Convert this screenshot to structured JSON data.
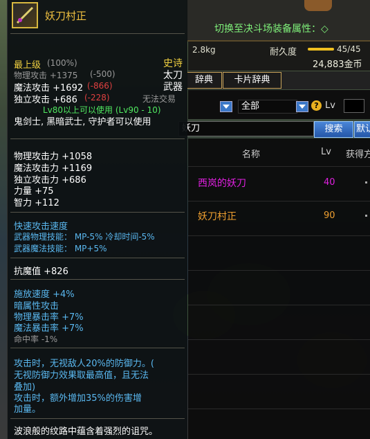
{
  "colors": {
    "accent_gold": "#f0c040",
    "red_penalty": "#e04040",
    "blue_text": "#5ab8f0",
    "green_text": "#50e860",
    "purple_item": "#e020e0",
    "orange_item": "#f0a030",
    "button_blue": "#3c78c8"
  },
  "tooltip": {
    "item_name": "妖刀村正",
    "icon": "katana-icon",
    "grade": "最上级",
    "grade_pct": "(100%)",
    "rarity": "史诗",
    "weapon_type": "太刀",
    "slot": "武器",
    "trade": "无法交易",
    "phys_atk": "物理攻击 +1375",
    "phys_diff": "(-500)",
    "mag_atk": "魔法攻击 +1692",
    "mag_diff": "(-866)",
    "ind_atk": "独立攻击 +686",
    "ind_diff": "(-228)",
    "level_req": "Lv80以上可以使用 (Lv90 - 10)",
    "classes": "鬼剑士, 黑暗武士, 守护者可以使用",
    "stats": [
      "物理攻击力 +1058",
      "魔法攻击力 +1169",
      "独立攻击力 +686",
      "力量 +75",
      "智力 +112"
    ],
    "speed_title": "快速攻击速度",
    "skill_phys": "武器物理技能： MP-5% 冷却时间-5%",
    "skill_mag": "武器魔法技能： MP+5%",
    "anti_magic": "抗魔值 +826",
    "effects": [
      "施放速度 +4%",
      "暗属性攻击",
      "物理暴击率 +7%",
      "魔法暴击率 +7%"
    ],
    "hit_rate": "命中率 -1%",
    "special_1": "攻击时，无视敌人20%的防御力。(",
    "special_2": "无视防御力效果取最高值，且无法",
    "special_3": "叠加)",
    "special_4": "    攻击时，额外增加35%的伤害增",
    "special_5": "加量。",
    "flavor": "波浪般的纹路中蕴含着强烈的诅咒。"
  },
  "background": {
    "switch_text": "切换至决斗场装备属性：◇",
    "weight": "2.8kg",
    "durability_label": "耐久度",
    "durability_value": "45/45",
    "durability_fraction": 1.0,
    "gold": "24,883金币",
    "tab_dict": "辞典",
    "tab_card": "卡片辞典",
    "filter_all": "全部",
    "lv_label": "Lv",
    "search_value": "妖刀",
    "search_button": "搜索",
    "default_button": "默认",
    "columns": [
      "名称",
      "Lv",
      "获得方"
    ],
    "rows": [
      {
        "name": "西岚的妖刀",
        "lv": "40"
      },
      {
        "name": "妖刀村正",
        "lv": "90"
      }
    ]
  }
}
